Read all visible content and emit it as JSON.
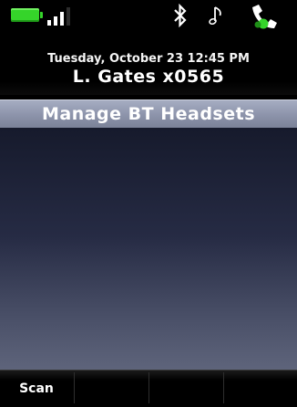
{
  "status": {
    "battery": "full",
    "signal_bars": 3,
    "icons": [
      "bluetooth-icon",
      "ringer-note-icon",
      "handset-icon"
    ],
    "colors": {
      "battery": "#35d42a",
      "handset_accent": "#35d42a"
    }
  },
  "header": {
    "datetime": "Tuesday, October 23 12:45 PM",
    "user_line": "L. Gates x0565"
  },
  "title": "Manage BT Headsets",
  "softkeys": [
    "Scan",
    "",
    "",
    ""
  ],
  "colors": {
    "titlebar": "#8c93aa",
    "content_top": "#161a2c",
    "content_bottom": "#5e647b"
  }
}
